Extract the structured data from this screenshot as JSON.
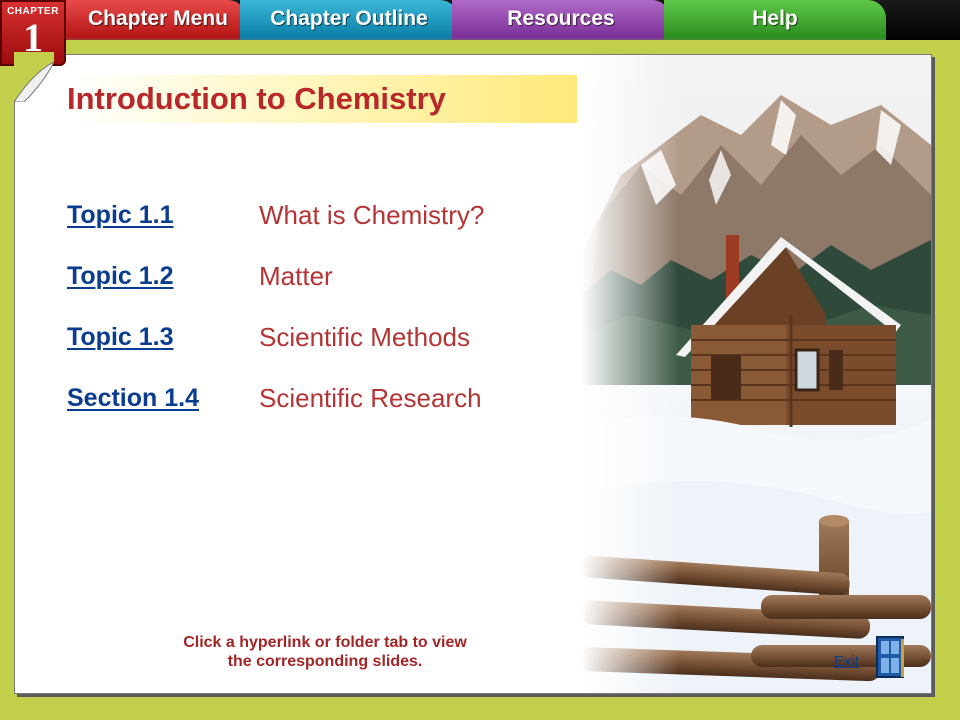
{
  "nav": {
    "chapter_badge_word": "CHAPTER",
    "chapter_badge_number": "1",
    "tabs": [
      {
        "label": "Chapter Menu"
      },
      {
        "label": "Chapter Outline"
      },
      {
        "label": "Resources"
      },
      {
        "label": "Help"
      }
    ]
  },
  "page": {
    "title": "Introduction to Chemistry"
  },
  "topics": [
    {
      "link": "Topic 1.1",
      "description": "What is Chemistry?"
    },
    {
      "link": "Topic 1.2",
      "description": "Matter"
    },
    {
      "link": "Topic 1.3",
      "description": "Scientific Methods"
    },
    {
      "link": "Section 1.4",
      "description": "Scientific Research"
    }
  ],
  "footer": {
    "instruction_line1": "Click a hyperlink or folder tab to view",
    "instruction_line2": "the corresponding slides.",
    "exit_label": "Exit"
  },
  "colors": {
    "frame": "#c2cf4a",
    "title": "#b8282a",
    "link": "#0a3d8f",
    "description": "#b43435"
  }
}
